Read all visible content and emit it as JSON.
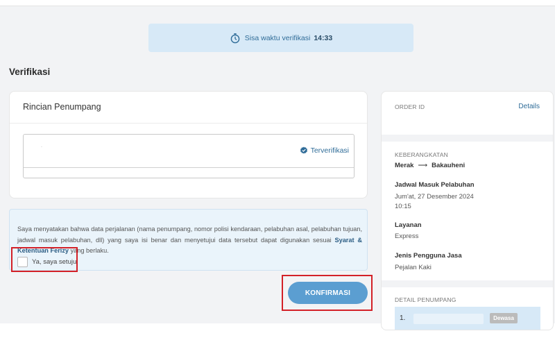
{
  "timer": {
    "icon": "stopwatch-icon",
    "label": "Sisa waktu verifikasi",
    "value": "14:33"
  },
  "heading": "Verifikasi",
  "passenger_details": {
    "title": "Rincian Penumpang",
    "placeholder_mark": "·",
    "verified_icon": "verified-check-icon",
    "verified_label": "Terverifikasi"
  },
  "consent": {
    "text_before": "Saya menyatakan bahwa data perjalanan (nama penumpang, nomor polisi kendaraan, pelabuhan asal, pelabuhan tujuan, jadwal masuk pelabuhan, dll) yang saya isi benar dan menyetujui data tersebut dapat digunakan sesuai ",
    "link": "Syarat & Ketentuan Ferizy",
    "text_after": " yang berlaku.",
    "checkbox_label": "Ya, saya setuju",
    "checked": false
  },
  "confirm_button": "KONFIRMASI",
  "highlight_color": "#d32027",
  "sidebar": {
    "order_id_label": "ORDER ID",
    "details_link": "Details",
    "departure_label": "KEBERANGKATAN",
    "origin": "Merak",
    "arrow": "⟶",
    "destination": "Bakauheni",
    "schedule_label": "Jadwal Masuk Pelabuhan",
    "schedule_date": "Jum'at, 27 Desember 2024",
    "schedule_time": "10:15",
    "service_label": "Layanan",
    "service_value": "Express",
    "user_type_label": "Jenis Pengguna Jasa",
    "user_type_value": "Pejalan Kaki",
    "passenger_detail_label": "DETAIL PENUMPANG",
    "passengers": [
      {
        "number": "1.",
        "type": "Dewasa"
      }
    ]
  }
}
